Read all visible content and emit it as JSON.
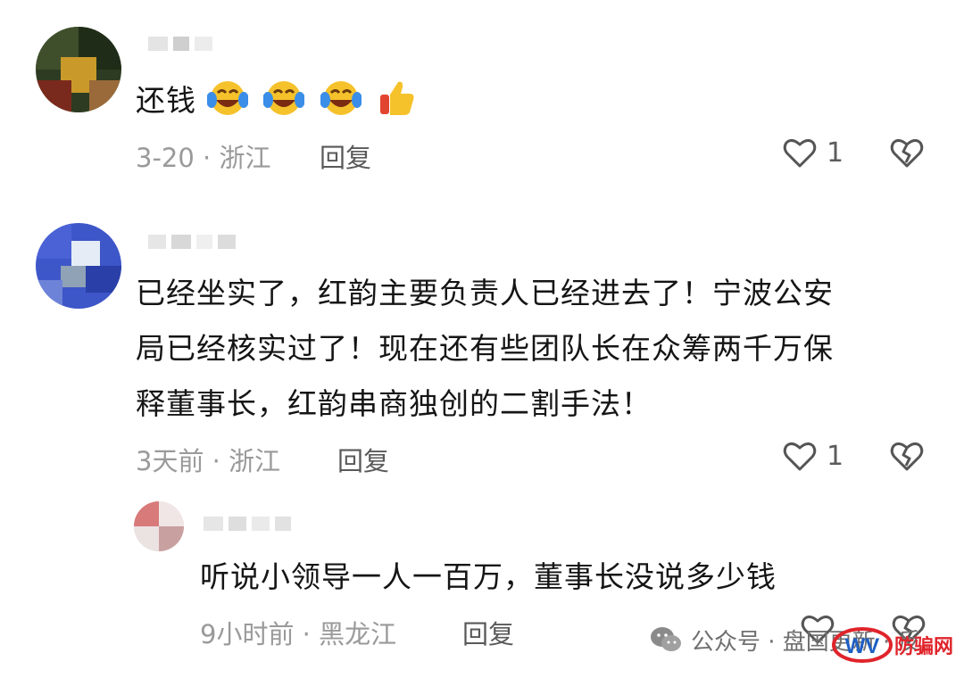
{
  "comments": [
    {
      "text_lines": [
        "还钱"
      ],
      "emojis": [
        "laughing-crying-emoji",
        "laughing-crying-emoji",
        "laughing-crying-emoji",
        "thumbs-up-emoji"
      ],
      "meta": "3-20 · 浙江",
      "reply_label": "回复",
      "likes": "1"
    },
    {
      "text_lines": [
        "已经坐实了，红韵主要负责人已经进去了！宁波公安",
        "局已经核实过了！现在还有些团队长在众筹两千万保",
        "释董事长，红韵串商独创的二割手法！"
      ],
      "meta": "3天前 · 浙江",
      "reply_label": "回复",
      "likes": "1"
    },
    {
      "text_lines": [
        "听说小领导一人一百万，董事长没说多少钱"
      ],
      "meta": "9小时前 · 黑龙江",
      "reply_label": "回复",
      "likes": ""
    }
  ],
  "watermark": {
    "text": "公众号 · 盘国更新 · 反",
    "icon": "wechat-icon"
  },
  "badge": {
    "logo_text": "WV",
    "site": "防骗网"
  },
  "colors": {
    "meta": "#9a9a9a",
    "reply": "#595959",
    "badge_red": "#e0242b",
    "badge_blue": "#1e5fc4"
  }
}
